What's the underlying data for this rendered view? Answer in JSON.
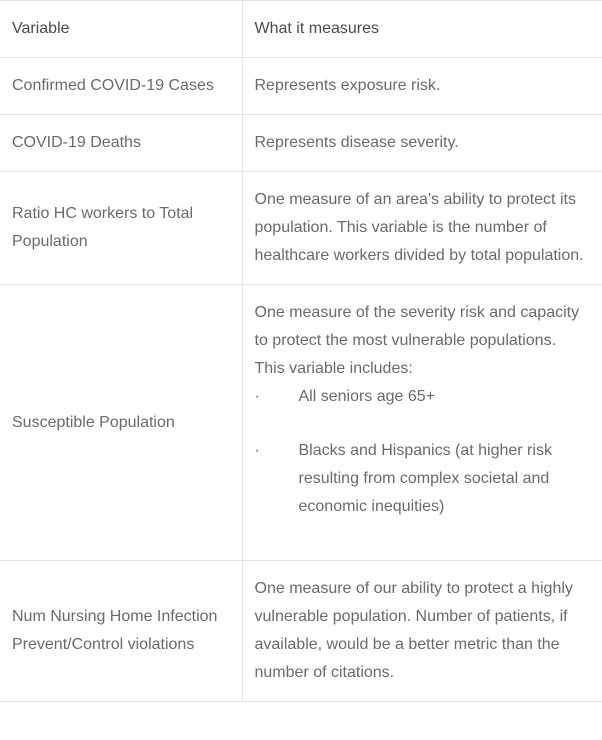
{
  "headers": {
    "col0": "Variable",
    "col1": "What it measures"
  },
  "rows": {
    "r0": {
      "variable": "Confirmed COVID-19 Cases",
      "desc_simple": "Represents exposure risk."
    },
    "r1": {
      "variable": "COVID-19 Deaths",
      "desc_simple": "Represents disease severity."
    },
    "r2": {
      "variable": "Ratio HC workers to Total Population",
      "desc_simple": "One measure of an area's ability to protect its population. This variable is the number of healthcare workers divided by total population."
    },
    "r3": {
      "variable": "Susceptible Population",
      "desc_intro": "One measure of the severity risk and capacity to protect the most vulnerable populations. This variable includes:",
      "bullet_dot": "·",
      "bullet1": "All seniors age 65+",
      "bullet2": "Blacks and Hispanics (at higher risk resulting from complex societal and economic inequities)"
    },
    "r4": {
      "variable": "Num Nursing Home Infection Prevent/Control violations",
      "desc_simple": "One measure of our ability to protect a highly vulnerable population. Number of patients, if available, would be a better metric than the number of citations."
    }
  }
}
